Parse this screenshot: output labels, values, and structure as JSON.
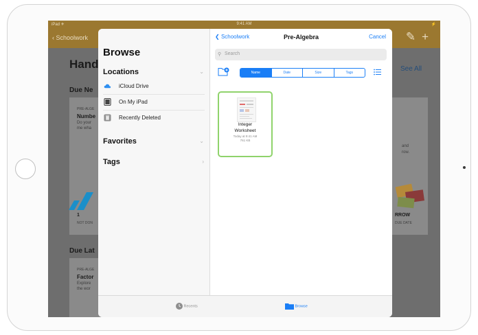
{
  "device": {
    "status_carrier": "iPad ✈",
    "status_time": "9:41 AM",
    "status_battery": "⚡"
  },
  "background_app": {
    "back_label": "Schoolwork",
    "heading": "Hand",
    "due_next_label": "Due Ne",
    "card1_tag": "PRE-ALGE",
    "card1_title": "Numbe",
    "card1_line1": "Do your",
    "card1_line2": "me wha",
    "card1_num": "1",
    "card1_sub": "NOT DON",
    "see_all": "See All",
    "right_text1": "and",
    "right_text2": "row.",
    "right_title": "RROW",
    "right_sub": "DUE DATE",
    "due_later_label": "Due Lat",
    "card2_tag": "PRE-ALGE",
    "card2_title": "Factor",
    "card2_line1": "Explore",
    "card2_line2": "the wor"
  },
  "sidebar": {
    "title": "Browse",
    "locations_header": "Locations",
    "locations": [
      {
        "label": "iCloud Drive",
        "icon": "cloud-icon"
      },
      {
        "label": "On My iPad",
        "icon": "ipad-icon"
      },
      {
        "label": "Recently Deleted",
        "icon": "trash-icon"
      }
    ],
    "favorites_header": "Favorites",
    "tags_header": "Tags"
  },
  "main": {
    "back_label": "Schoolwork",
    "title": "Pre-Algebra",
    "cancel_label": "Cancel",
    "search_placeholder": "Search",
    "sort_options": [
      "Name",
      "Date",
      "Size",
      "Tags"
    ],
    "selected_sort": "Name",
    "file": {
      "name_line1": "Integer",
      "name_line2": "Worksheet",
      "date": "Today at 9:41 AM",
      "size": "761 KB"
    }
  },
  "tabbar": {
    "recents_label": "Recents",
    "browse_label": "Browse",
    "active": "Browse"
  },
  "colors": {
    "accent": "#1a7ef6",
    "selection": "#8fd36b",
    "app_bar": "#9b7830",
    "dim_overlay": "#6c6c6c"
  }
}
